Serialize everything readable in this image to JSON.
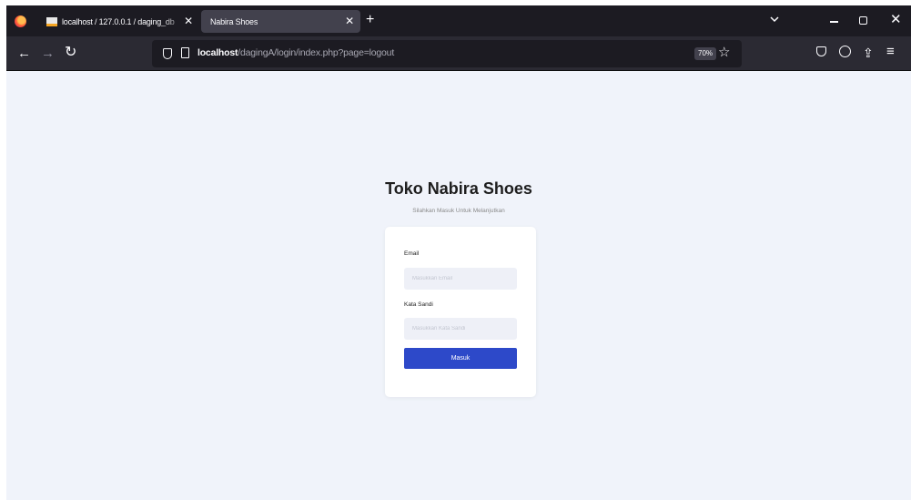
{
  "browser": {
    "tabs": [
      {
        "title": "localhost / 127.0.0.1 / daging_db",
        "active": false,
        "close": "✕"
      },
      {
        "title": "Nabira Shoes",
        "active": true,
        "close": "✕"
      }
    ],
    "new_tab": "+",
    "url_host": "localhost",
    "url_path": "/dagingA/login/index.php?page=logout",
    "zoom": "70%",
    "icons": [
      "firefox-logo",
      "back-arrow",
      "forward-arrow",
      "reload",
      "shield",
      "page",
      "star",
      "pocket",
      "account",
      "extensions",
      "menu",
      "tab-list",
      "minimize",
      "maximize",
      "close"
    ]
  },
  "page": {
    "title": "Toko Nabira Shoes",
    "subtitle": "Silahkan Masuk Untuk Melanjutkan",
    "form": {
      "email_label": "Email",
      "email_placeholder": "Masukkan Email",
      "email_value": "",
      "password_label": "Kata Sandi",
      "password_placeholder": "Masukkan Kata Sandi",
      "password_value": "",
      "submit_label": "Masuk"
    }
  },
  "colors": {
    "page_bg": "#f0f3fa",
    "button": "#2d49c9",
    "tabstrip": "#1c1b22",
    "navbar": "#2b2a33"
  }
}
